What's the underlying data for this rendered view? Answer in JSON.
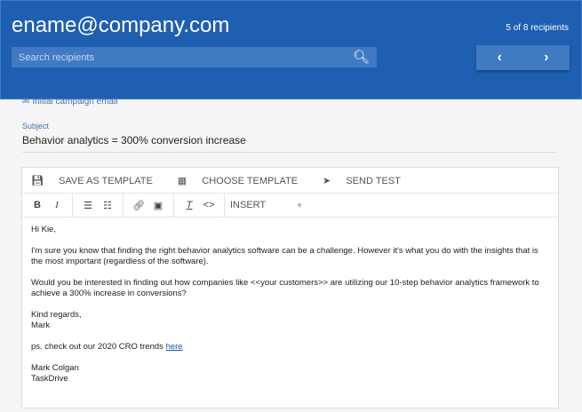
{
  "header": {
    "title": "ename@company.com",
    "count": "5 of 8 recipients",
    "search_placeholder": "Search recipients",
    "prev": "‹",
    "next": "›"
  },
  "campaign": {
    "label": "Initial campaign email"
  },
  "subject": {
    "label": "Subject",
    "value": "Behavior analytics = 300% conversion increase"
  },
  "toolbar": {
    "save_template": "SAVE AS TEMPLATE",
    "choose_template": "CHOOSE TEMPLATE",
    "send_test": "SEND TEST",
    "insert": "INSERT"
  },
  "body": {
    "greeting": "Hi Kie,",
    "p1": "I'm sure you know that finding the right behavior analytics software can be a challenge. However it's what you do with the insights that is the most important (regardless of the software).",
    "p2": "Would you be interested in finding out how companies like <<your customers>> are utilizing our 10-step behavior analytics framework to achieve a 300% increase in conversions?",
    "closing": "Kind regards,",
    "name": "Mark",
    "ps": "ps. check out our 2020 CRO trends ",
    "ps_link": "here",
    "sig_name": "Mark Colgan",
    "sig_company": "TaskDrive"
  }
}
